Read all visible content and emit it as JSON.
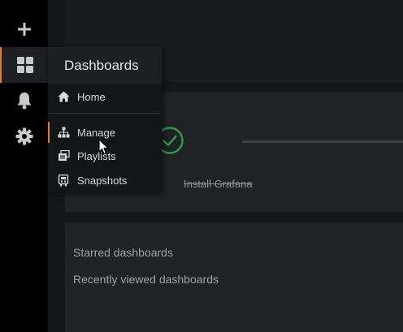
{
  "sidebar": {
    "items": [
      {
        "icon": "plus-icon"
      },
      {
        "icon": "dashboards-grid-icon",
        "active": true
      },
      {
        "icon": "bell-icon"
      },
      {
        "icon": "gear-icon"
      }
    ]
  },
  "flyout": {
    "title": "Dashboards",
    "items": [
      {
        "label": "Home",
        "icon": "home-icon"
      },
      {
        "label": "Manage",
        "icon": "sitemap-icon",
        "active": true
      },
      {
        "label": "Playlists",
        "icon": "playlist-icon"
      },
      {
        "label": "Snapshots",
        "icon": "snapshot-icon"
      }
    ]
  },
  "onboarding": {
    "step_label": "Install Grafana",
    "step_complete": true
  },
  "lists": {
    "starred": "Starred dashboards",
    "recent": "Recently viewed dashboards"
  },
  "colors": {
    "accent": "#eb7b18",
    "success": "#299c46",
    "sidebar_bg": "#000000",
    "page_bg": "#161719"
  }
}
